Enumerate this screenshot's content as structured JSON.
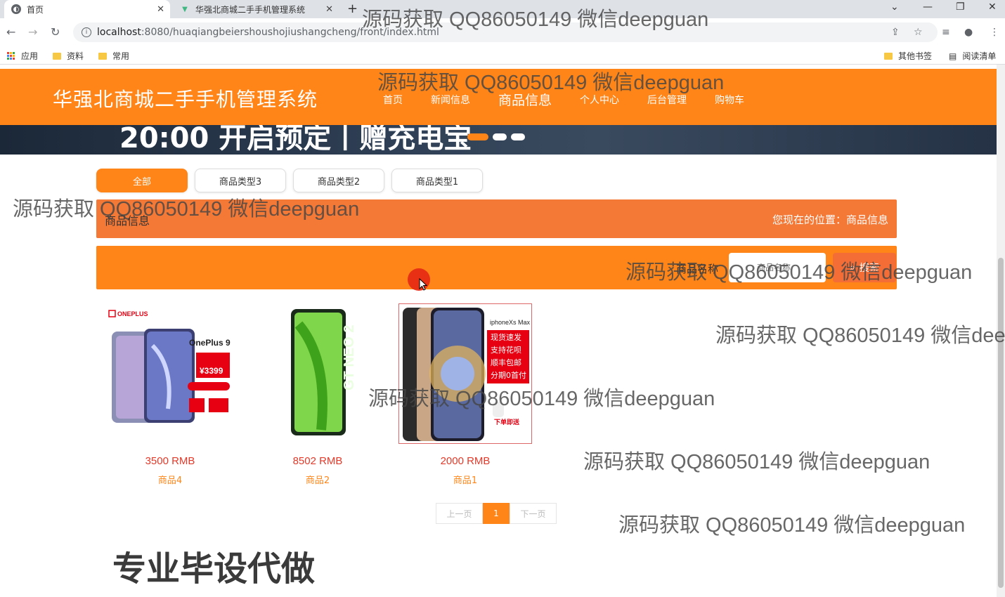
{
  "browser": {
    "tabs": [
      {
        "title": "首页",
        "icon": "globe-icon",
        "active": true
      },
      {
        "title": "华强北商城二手手机管理系统",
        "icon": "vue-icon",
        "active": false
      }
    ],
    "url_host": "localhost",
    "url_path": ":8080/huaqiangbeiershoushojiushangcheng/front/index.html",
    "bookmarks": [
      "应用",
      "资料",
      "常用"
    ],
    "bookmarks_right": [
      "其他书签",
      "阅读清单"
    ]
  },
  "site": {
    "title": "华强北商城二手手机管理系统",
    "nav": [
      "首页",
      "新闻信息",
      "商品信息",
      "个人中心",
      "后台管理",
      "购物车"
    ],
    "nav_current": "商品信息"
  },
  "banner": {
    "text": "20:00 开启预定丨赠充电宝"
  },
  "categories": [
    "全部",
    "商品类型3",
    "商品类型2",
    "商品类型1"
  ],
  "breadcrumb": {
    "title": "商品信息",
    "location": "您现在的位置：商品信息"
  },
  "search": {
    "label": "商品名称",
    "placeholder": "商品名称",
    "button": "搜索"
  },
  "products": [
    {
      "price": "3500 RMB",
      "name": "商品4",
      "image": "oneplus-9-phone-image",
      "img_text": [
        "ONEPLUS",
        "OnePlus 9",
        "¥3399"
      ]
    },
    {
      "price": "8502 RMB",
      "name": "商品2",
      "image": "realme-gt-neo2-phone-image",
      "img_text": [
        "GT NEO 2"
      ]
    },
    {
      "price": "2000 RMB",
      "name": "商品1",
      "image": "iphone-xs-max-phone-image",
      "img_text": [
        "iphoneXs Max",
        "现货速发",
        "支持花呗",
        "顺丰包邮",
        "分期0首付",
        "下单即送"
      ]
    }
  ],
  "pagination": {
    "prev": "上一页",
    "current": "1",
    "next": "下一页"
  },
  "overlay": {
    "promo": "专业毕设代做",
    "watermark": "源码获取 QQ86050149 微信deepguan"
  },
  "colors": {
    "accent": "#ff8518",
    "crumb": "#f47836",
    "price": "#e23a2a"
  }
}
